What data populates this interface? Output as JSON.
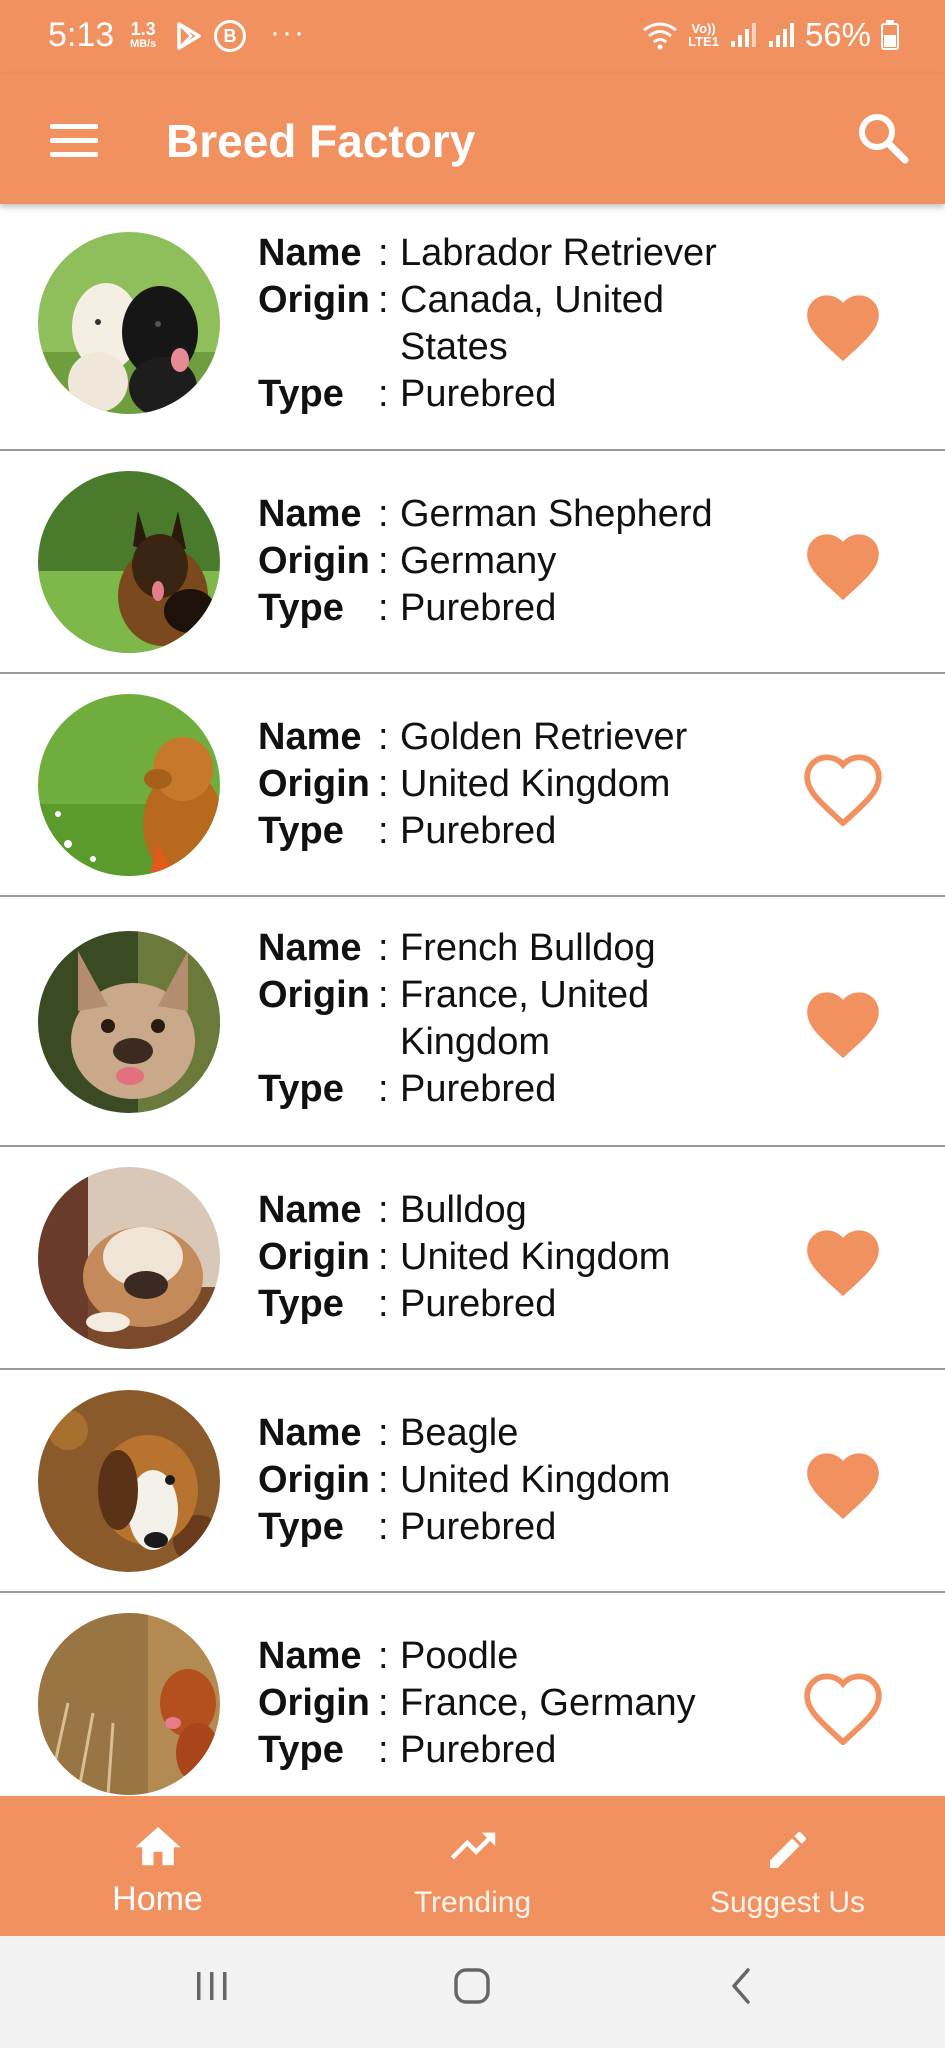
{
  "status_bar": {
    "time": "5:13",
    "net_speed_value": "1.3",
    "net_speed_unit": "MB/s",
    "more": "···",
    "lte_top": "Vo))",
    "lte_bottom": "LTE1",
    "battery": "56%"
  },
  "app_bar": {
    "title": "Breed Factory",
    "menu_icon": "hamburger-menu-icon",
    "search_icon": "search-icon"
  },
  "labels": {
    "name": "Name",
    "origin": "Origin",
    "type": "Type",
    "colon": ":"
  },
  "breeds": [
    {
      "name": "Labrador Retriever",
      "origin": "Canada, United States",
      "type": "Purebred",
      "favorite": true
    },
    {
      "name": "German Shepherd",
      "origin": "Germany",
      "type": "Purebred",
      "favorite": true
    },
    {
      "name": "Golden Retriever",
      "origin": "United Kingdom",
      "type": "Purebred",
      "favorite": false
    },
    {
      "name": "French Bulldog",
      "origin": "France, United Kingdom",
      "type": "Purebred",
      "favorite": true
    },
    {
      "name": "Bulldog",
      "origin": "United Kingdom",
      "type": "Purebred",
      "favorite": true
    },
    {
      "name": "Beagle",
      "origin": "United Kingdom",
      "type": "Purebred",
      "favorite": true
    },
    {
      "name": "Poodle",
      "origin": "France, Germany",
      "type": "Purebred",
      "favorite": false
    }
  ],
  "bottom_nav": {
    "home": "Home",
    "trending": "Trending",
    "suggest": "Suggest Us"
  },
  "colors": {
    "accent": "#F29160",
    "divider": "#9a9a9a",
    "system_nav": "#f2f2f2"
  }
}
